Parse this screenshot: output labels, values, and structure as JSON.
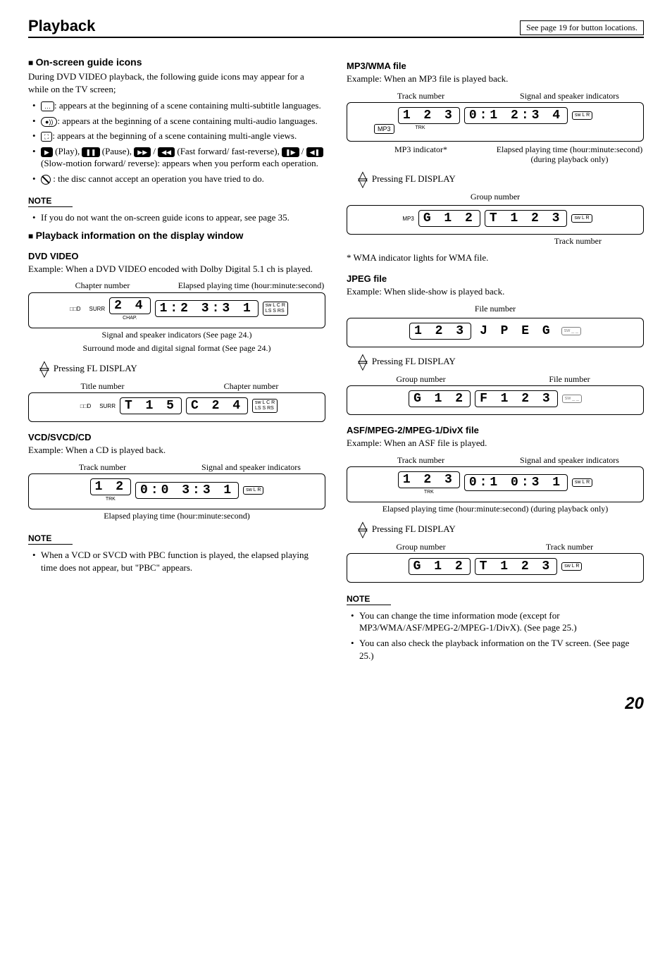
{
  "header": {
    "title": "Playback",
    "reference": "See page 19 for button locations."
  },
  "left": {
    "sec1": {
      "heading": "On-screen guide icons",
      "intro": "During DVD VIDEO playback, the following guide icons may appear for a while on the TV screen;",
      "bullets": {
        "b1a": ": appears at the beginning of a scene containing multi-subtitle languages.",
        "b2a": ": appears at the beginning of a scene containing multi-audio languages.",
        "b3a": ": appears at the beginning of a scene containing multi-angle views.",
        "b4_play": " (Play), ",
        "b4_pause": " (Pause), ",
        "b4_ff": " (Fast forward/ fast-reverse), ",
        "b4_slow": " (Slow-motion forward/ reverse): appears when you perform each operation.",
        "b5": " : the disc cannot accept an operation you have tried to do."
      },
      "note_heading": "NOTE",
      "note_item": "If you do not want the on-screen guide icons to appear, see page 35."
    },
    "sec2": {
      "heading": "Playback information on the display window",
      "dvd": {
        "title": "DVD VIDEO",
        "example": "Example: When a DVD VIDEO encoded with Dolby Digital 5.1 ch is played.",
        "call_chapter": "Chapter number",
        "call_time": "Elapsed playing time (hour:minute:second)",
        "seg_chap": "2 4",
        "seg_time": "1:2 3:3 1",
        "surr_label": "SURR",
        "chap_label": "CHAP.",
        "ind_caption": "Signal and speaker indicators (See page 24.)",
        "surr_caption": "Surround mode and digital signal format (See page 24.)",
        "pressing": "Pressing FL DISPLAY",
        "call_title": "Title number",
        "call_chapter2": "Chapter number",
        "seg_title": "T 1 5",
        "seg_chap2": "C 2 4"
      },
      "cd": {
        "title": "VCD/SVCD/CD",
        "example": "Example: When a CD is played back.",
        "call_track": "Track number",
        "call_ind": "Signal and speaker indicators",
        "seg_track": "1 2",
        "seg_time": "0:0 3:3 1",
        "trk_label": "TRK",
        "time_caption": "Elapsed playing time (hour:minute:second)",
        "note_heading": "NOTE",
        "note_item": "When a VCD or SVCD with PBC function is played, the elapsed playing time does not appear, but \"PBC\" appears."
      }
    }
  },
  "right": {
    "mp3": {
      "title": "MP3/WMA file",
      "example": "Example: When an MP3 file is played back.",
      "call_track": "Track number",
      "call_ind": "Signal and speaker indicators",
      "seg_track": "1 2 3",
      "seg_time": "0:1 2:3 4",
      "mp3_label": "MP3",
      "trk_label": "TRK",
      "call_mp3ind": "MP3 indicator*",
      "call_elapsed": "Elapsed playing time (hour:minute:second) (during playback only)",
      "pressing": "Pressing FL DISPLAY",
      "call_group": "Group number",
      "seg_group": "G 1 2",
      "seg_track2": "T 1 2 3",
      "call_track2": "Track number",
      "footnote": "* WMA indicator lights for WMA file."
    },
    "jpeg": {
      "title": "JPEG file",
      "example": "Example: When slide-show is played back.",
      "call_file": "File number",
      "seg_file": "1 2 3",
      "seg_jpeg": "J P E G",
      "pressing": "Pressing FL DISPLAY",
      "call_group": "Group number",
      "call_file2": "File number",
      "seg_group": "G 1 2",
      "seg_file2": "F 1 2 3"
    },
    "asf": {
      "title": "ASF/MPEG-2/MPEG-1/DivX file",
      "example": "Example: When an ASF file is played.",
      "call_track": "Track number",
      "call_ind": "Signal and speaker indicators",
      "seg_track": "1 2 3",
      "seg_time": "0:1 0:3 1",
      "trk_label": "TRK",
      "call_elapsed": "Elapsed playing time (hour:minute:second) (during playback only)",
      "pressing": "Pressing FL DISPLAY",
      "call_group": "Group number",
      "call_track2": "Track number",
      "seg_group": "G 1 2",
      "seg_track2": "T 1 2 3",
      "note_heading": "NOTE",
      "note1": "You can change the time information mode (except for MP3/WMA/ASF/MPEG-2/MPEG-1/DivX). (See page 25.)",
      "note2": "You can also check the playback information on the TV screen. (See page 25.)"
    }
  },
  "page_number": "20",
  "icons": {
    "subtitle": "…",
    "audio": "●))",
    "angle": "⛶",
    "play": "▶",
    "pause": "❚❚",
    "ff": "▶▶",
    "rw": "◀◀",
    "sf": "❚▶",
    "sr": "◀❚",
    "ind_line1": "sw L C R",
    "ind_line2": "LS S RS",
    "ind_small": "sw L  R",
    "dd": "□□D"
  }
}
